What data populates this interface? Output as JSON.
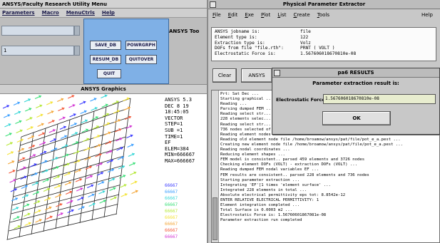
{
  "ansys": {
    "title": "ANSYS/Faculty Research Utility Menu",
    "menu": [
      "Parameters",
      "Macro",
      "MenuCtrls",
      "Help"
    ],
    "toolbar_label": "ANSYS Too",
    "input_field_1": "",
    "input_field_2": "1",
    "toolbar_buttons": [
      "SAVE_DB",
      "POWRGRPH",
      "RESUM_DB",
      "QUITOVER",
      "QUIT"
    ],
    "graphics_title": "ANSYS Graphics",
    "graphics_info": [
      "ANSYS 5.3",
      "DEC 8 19",
      "18:45:05",
      "VECTOR",
      "STEP=1",
      "SUB =1",
      "TIME=1",
      "EF",
      "ELEM=384",
      "MIN=666667",
      "MAX=666667"
    ],
    "legend_colors": [
      "#3d3dff",
      "#3da0ff",
      "#37d6d6",
      "#3de07a",
      "#b6e83a",
      "#f4e33a",
      "#f4a73a",
      "#f45a3a",
      "#d43ad4"
    ],
    "legend_values": [
      "66667",
      "66667",
      "66667",
      "66667",
      "66667",
      "66667",
      "66667",
      "66667",
      "66667"
    ]
  },
  "ppe": {
    "title": "Physical Parameter Extractor",
    "menu": [
      "File",
      "Edit",
      "Exe",
      "Plot",
      "List",
      "Create",
      "Tools"
    ],
    "help": "Help",
    "info": [
      {
        "label": "ANSYS jobname is:",
        "value": "file"
      },
      {
        "label": "Element type is:",
        "value": "122"
      },
      {
        "label": "Extraction type is:",
        "value": "Volz"
      },
      {
        "label": "DOFs from file \"file.rth\":",
        "value": "PRNT ( VOLT )"
      },
      {
        "label": "Electrostatic Force is:",
        "value": "1.567606018670810e-08"
      }
    ],
    "buttons": [
      "Clear",
      "ANSYS"
    ],
    "console": [
      "Prt:   Sat Dec  ...",
      "Starting graphical ...",
      "Reading ... ",
      "Parsing dumped FEM ...",
      "Reading select str...",
      "228 elements selec...",
      "Reading select str...",
      "736 nodes selected of 3726 in total ...",
      "Reading element nodes ...",
      "Reading old element node file /home/broamow/ansys/pat/file/pot_e_a.pest ...",
      "Creating new element node file /home/broamow/ansys/pat/file/pot_e_a.pest ...",
      "Reading nodal coordinates ...",
      "Reducing element shapes ...",
      "FEM model is consistent.. parsed 459 elements and 3726 nodes",
      "Checking element DOFs (VOLT) - extraction DOFs (VOLT) ...",
      "Reading dumped FEM nodal variables EF ...",
      "FEM results are consistent.. parsed 228 elements and 736 nodes",
      "Starting parameter extraction ...",
      "Integrating 'EF'[1 times 'element surface' ...",
      "Integrated 228 elements in total ...",
      "Absolute electrical permittivity eps tot: 8.8542e-12",
      "ENTER RELATIVE ELECTRICAL PERMITTIVITY: 1",
      "Element integration completed ...",
      "Total Surface is 0.0003 m2 ...",
      "Electrostatic Force is: 1.56760601867081e-08",
      "Parameter extraction run completed"
    ]
  },
  "dialog": {
    "title": "pa6 RESULTS",
    "message": "Parameter extraction result is:",
    "field_label": "Electrostatic Force:",
    "field_value": "1.567606018670810e-08",
    "ok_label": "OK"
  }
}
